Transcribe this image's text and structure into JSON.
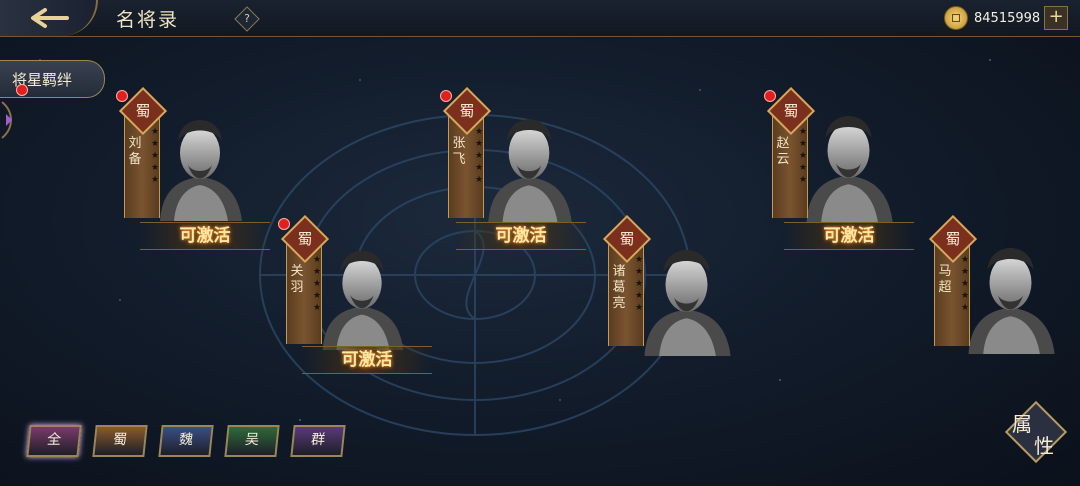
{
  "header": {
    "title": "名将录",
    "help_label": "?",
    "currency_value": "84515998",
    "add_label": "+"
  },
  "side_tab": {
    "label": "将星羁绊",
    "has_notification": true
  },
  "heroes": [
    {
      "id": "liubei",
      "faction": "蜀",
      "name": "刘备",
      "stars": "★★★★★",
      "action": "可激活",
      "has_notification": true
    },
    {
      "id": "guanyu",
      "faction": "蜀",
      "name": "关羽",
      "stars": "★★★★★",
      "action": "可激活",
      "has_notification": true
    },
    {
      "id": "zhangfei",
      "faction": "蜀",
      "name": "张飞",
      "stars": "★★★★★",
      "action": "可激活",
      "has_notification": true
    },
    {
      "id": "zhugeliang",
      "faction": "蜀",
      "name": "诸葛亮",
      "stars": "★★★★★",
      "action": "",
      "has_notification": false
    },
    {
      "id": "zhaoyun",
      "faction": "蜀",
      "name": "赵云",
      "stars": "★★★★★",
      "action": "可激活",
      "has_notification": true
    },
    {
      "id": "machao",
      "faction": "蜀",
      "name": "马超",
      "stars": "★★★★★",
      "action": "",
      "has_notification": false
    }
  ],
  "filters": [
    {
      "label": "全",
      "color": "#7a3a6a",
      "selected": true
    },
    {
      "label": "蜀",
      "color": "#8a5a2a",
      "selected": false
    },
    {
      "label": "魏",
      "color": "#3a4f86",
      "selected": false
    },
    {
      "label": "吴",
      "color": "#2f6a3a",
      "selected": false
    },
    {
      "label": "群",
      "color": "#5a3a7a",
      "selected": false
    }
  ],
  "attribute_button": {
    "char1": "属",
    "char2": "性"
  },
  "colors": {
    "accent_gold": "#d6a85c",
    "notification": "#e02020"
  }
}
